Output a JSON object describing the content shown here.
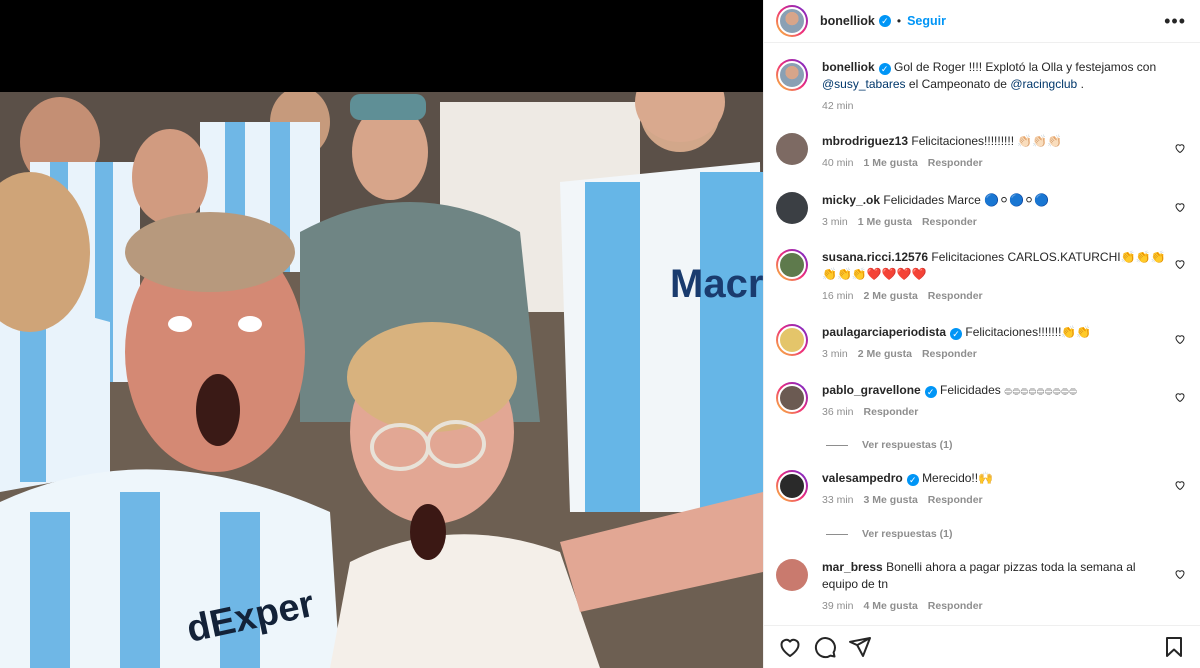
{
  "post": {
    "username": "bonelliok",
    "follow_label": "Seguir",
    "more_label": "•••",
    "dot": "•",
    "caption": {
      "username": "bonelliok",
      "text_1": "Gol de Roger !!!! Explotó la Olla y festejamos con",
      "mention_1": "@susy_tabares",
      "text_2": "el Campeonato de",
      "mention_2": "@racingclub",
      "text_3": ".",
      "time": "42 min"
    }
  },
  "comments": [
    {
      "username": "mbrodriguez13",
      "text": "Felicitaciones!!!!!!!!! 👏🏻👏🏻👏🏻",
      "time": "40 min",
      "likes": "1 Me gusta",
      "reply": "Responder",
      "verified": false
    },
    {
      "username": "micky_.ok",
      "text": "Felicidades Marce 🔵⚪🔵⚪🔵",
      "time": "3 min",
      "likes": "1 Me gusta",
      "reply": "Responder",
      "verified": false
    },
    {
      "username": "susana.ricci.12576",
      "text": "Felicitaciones CARLOS.KATURCHI👏👏👏👏👏👏❤️❤️❤️❤️",
      "time": "16 min",
      "likes": "2 Me gusta",
      "reply": "Responder",
      "verified": false
    },
    {
      "username": "paulagarciaperiodista",
      "text": "Felicitaciones!!!!!!!👏👏",
      "time": "3 min",
      "likes": "2 Me gusta",
      "reply": "Responder",
      "verified": true
    },
    {
      "username": "pablo_gravellone",
      "text": "Felicidades 𓐍𓐍𓐍𓐍𓐍𓐍𓐍𓐍𓐍",
      "time": "36 min",
      "likes": "",
      "reply": "Responder",
      "verified": true,
      "view_replies": "Ver respuestas (1)"
    },
    {
      "username": "valesampedro",
      "text": "Merecido!!🙌",
      "time": "33 min",
      "likes": "3 Me gusta",
      "reply": "Responder",
      "verified": true,
      "view_replies": "Ver respuestas (1)"
    },
    {
      "username": "mar_bress",
      "text": "Bonelli ahora a pagar pizzas toda la semana al equipo de tn",
      "time": "39 min",
      "likes": "4 Me gusta",
      "reply": "Responder",
      "verified": false
    }
  ],
  "colors": {
    "accent": "#0095f6",
    "muted": "#8e8e8e",
    "text": "#262626",
    "link": "#00376b"
  },
  "icons": [
    "heart-icon",
    "comment-icon",
    "share-icon",
    "bookmark-icon",
    "more-icon",
    "verified-icon"
  ]
}
